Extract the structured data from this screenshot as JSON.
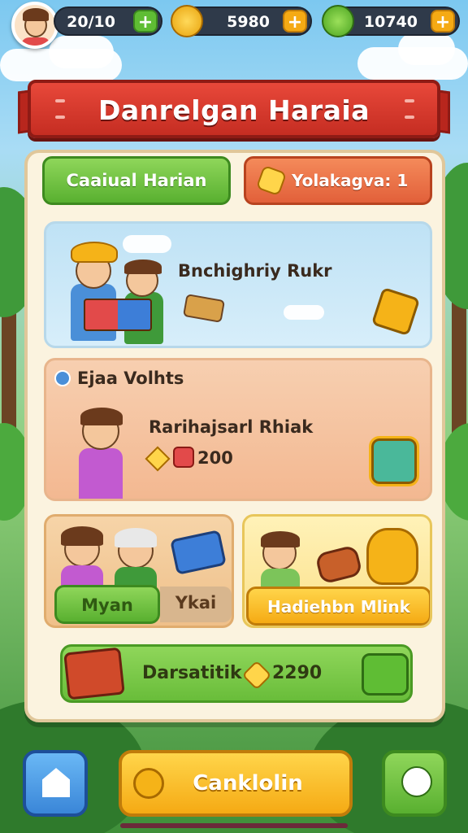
{
  "resources": {
    "r1": "20/10",
    "r2": "5980",
    "r3": "10740"
  },
  "header": {
    "title": "Danrelgan Haraia"
  },
  "tabs": {
    "left": "Caaiual Harian",
    "right": "Yolakagva: 1"
  },
  "cards": {
    "first": {
      "label": "Bnchighriy Rukr"
    },
    "second": {
      "heading": "Ejaa Volhts",
      "label": "Rarihajsarl Rhiak",
      "reward": "200"
    },
    "third": {
      "button_left": "Myan",
      "button_right": "Ykai"
    },
    "fourth": {
      "button": "Hadiehbn Mlink"
    },
    "reward_bar": {
      "label": "Darsatitik",
      "amount": "2290"
    }
  },
  "bottom": {
    "center": "Canklolin"
  },
  "colors": {
    "green": "#59b030",
    "orange": "#e2603a",
    "yellow": "#f5aa14",
    "red_banner": "#c52d22",
    "panel": "#fbf3df"
  },
  "icons": [
    "avatar",
    "coin-icon",
    "leaf-gem-icon",
    "plus-icon",
    "star-icon",
    "ticket-icon",
    "home-icon",
    "clock-icon",
    "chat-icon",
    "chest-icon"
  ]
}
